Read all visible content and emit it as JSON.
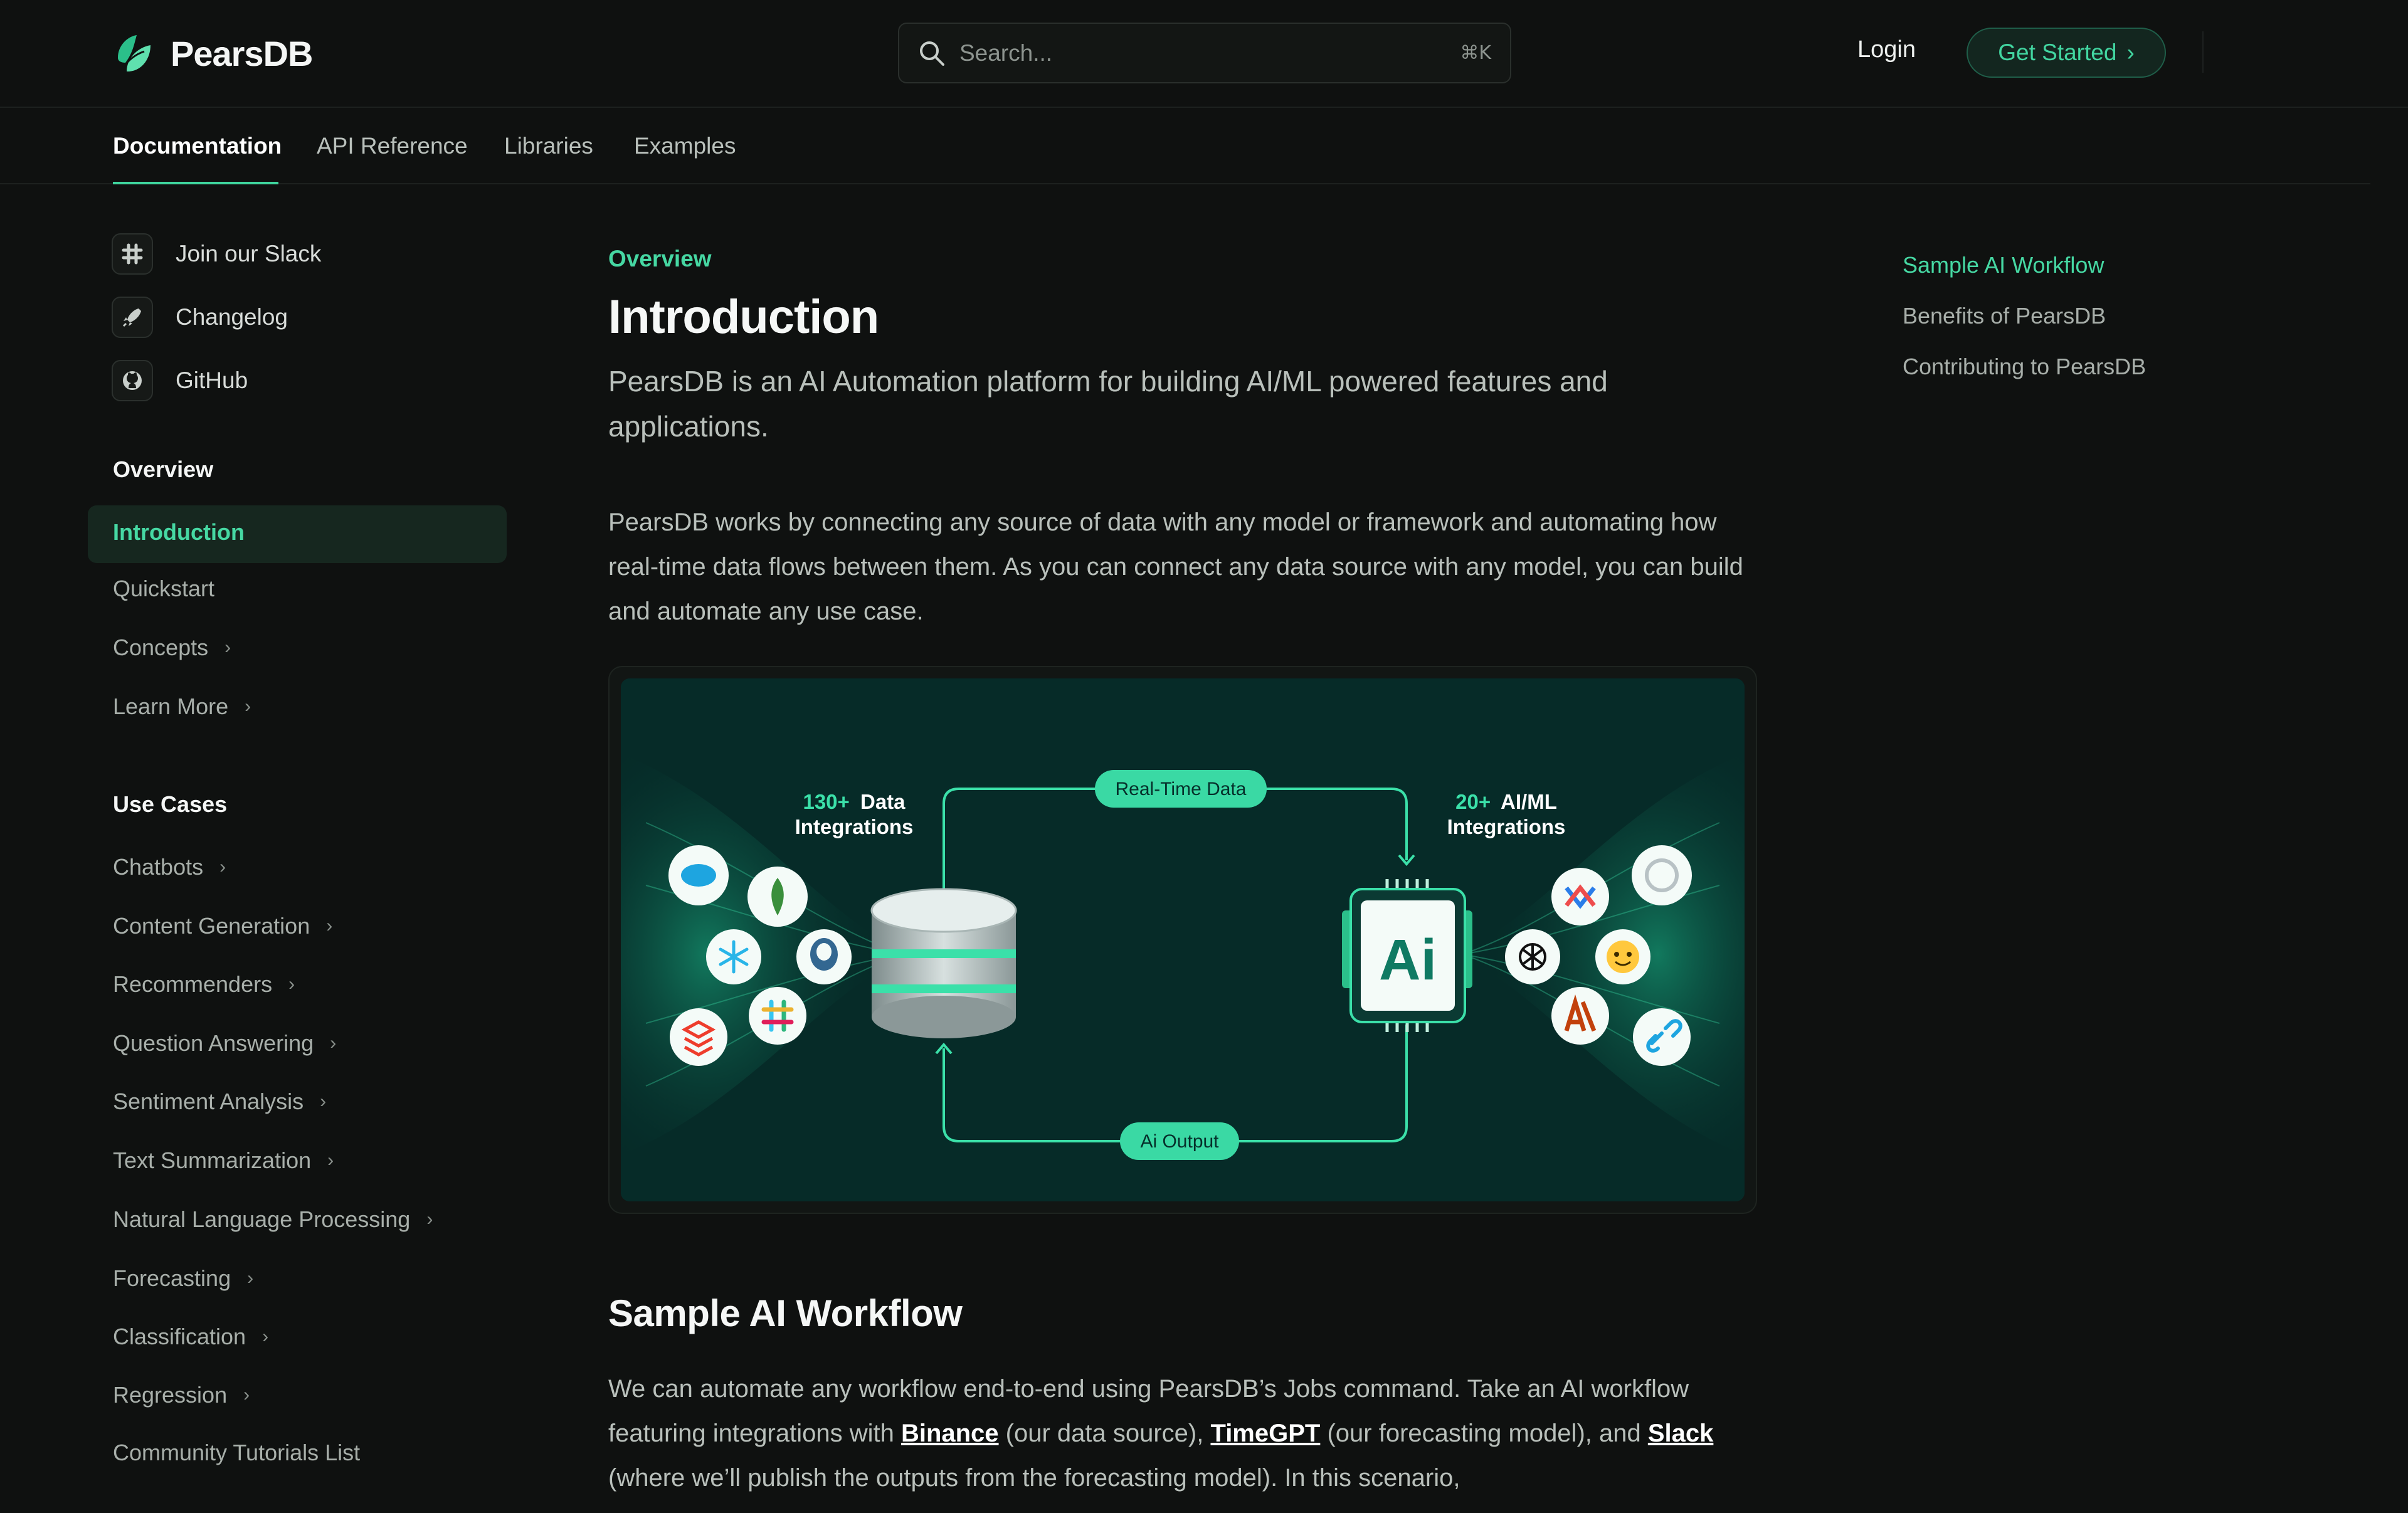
{
  "brand": {
    "name": "PearsDB",
    "accent": "#3fd59e"
  },
  "header": {
    "search_placeholder": "Search...",
    "search_shortcut": "⌘K",
    "login_label": "Login",
    "cta_label": "Get Started",
    "cta_chevron": "›"
  },
  "tabs": [
    {
      "label": "Documentation",
      "active": true
    },
    {
      "label": "API Reference"
    },
    {
      "label": "Libraries"
    },
    {
      "label": "Examples"
    }
  ],
  "sidebar": {
    "links": [
      {
        "label": "Join our Slack",
        "icon": "slack-icon"
      },
      {
        "label": "Changelog",
        "icon": "rocket-icon"
      },
      {
        "label": "GitHub",
        "icon": "github-icon"
      }
    ],
    "overview_heading": "Overview",
    "overview_items": [
      {
        "label": "Introduction",
        "active": true
      },
      {
        "label": "Quickstart"
      },
      {
        "label": "Concepts",
        "chevron": "›"
      },
      {
        "label": "Learn More",
        "chevron": "›"
      }
    ],
    "usecases_heading": "Use Cases",
    "usecases_items": [
      {
        "label": "Chatbots",
        "chevron": "›"
      },
      {
        "label": "Content Generation",
        "chevron": "›"
      },
      {
        "label": "Recommenders",
        "chevron": "›"
      },
      {
        "label": "Question Answering",
        "chevron": "›"
      },
      {
        "label": "Sentiment Analysis",
        "chevron": "›"
      },
      {
        "label": "Text Summarization",
        "chevron": "›"
      },
      {
        "label": "Natural Language Processing",
        "chevron": "›"
      },
      {
        "label": "Forecasting",
        "chevron": "›"
      },
      {
        "label": "Classification",
        "chevron": "›"
      },
      {
        "label": "Regression",
        "chevron": "›"
      },
      {
        "label": "Community Tutorials List"
      }
    ]
  },
  "main": {
    "eyebrow": "Overview",
    "title": "Introduction",
    "lead": "PearsDB is an AI Automation platform for building AI/ML powered features and applications.",
    "paragraph": "PearsDB works by connecting any source of data with any model or framework and automating how real-time data flows between them. As you can connect any data source with any model, you can build and automate any use case.",
    "diagram": {
      "left_count": "130+",
      "left_label_1": "Data",
      "left_label_2": "Integrations",
      "right_count": "20+",
      "right_label_1": "AI/ML",
      "right_label_2": "Integrations",
      "top_pill": "Real-Time Data",
      "bottom_pill": "Ai Output",
      "chip_label": "Ai"
    },
    "section_title": "Sample AI Workflow",
    "section_text_1": "We can automate any workflow end-to-end using PearsDB’s Jobs command. Take an AI workflow featuring integrations with ",
    "link_binance": "Binance",
    "section_text_2": " (our data source), ",
    "link_timegpt": "TimeGPT",
    "section_text_3": " (our forecasting model), and ",
    "link_slack": "Slack",
    "section_text_4": " (where we’ll publish the outputs from the forecasting model). In this scenario,"
  },
  "toc": [
    {
      "label": "Sample AI Workflow",
      "active": true
    },
    {
      "label": "Benefits of PearsDB"
    },
    {
      "label": "Contributing to PearsDB"
    }
  ]
}
